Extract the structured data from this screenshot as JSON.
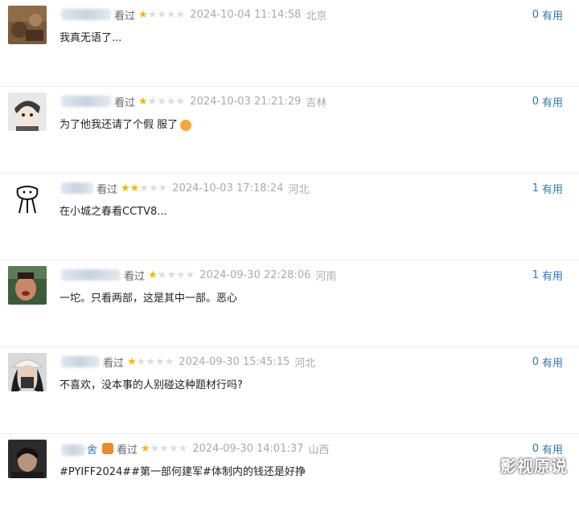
{
  "reviews": [
    {
      "user_suffix": "",
      "action": "看过",
      "rating": 1,
      "time": "2024-10-04 11:14:58",
      "location": "北京",
      "content": "我真无语了...",
      "votes": "0",
      "useful_label": "有用"
    },
    {
      "user_suffix": "",
      "action": "看过",
      "rating": 1,
      "time": "2024-10-03 21:21:29",
      "location": "吉林",
      "content": "为了他我还请了个假 服了",
      "votes": "0",
      "useful_label": "有用"
    },
    {
      "user_suffix": "",
      "action": "看过",
      "rating": 2,
      "time": "2024-10-03 17:18:24",
      "location": "河北",
      "content": "在小城之春看CCTV8...",
      "votes": "1",
      "useful_label": "有用"
    },
    {
      "user_suffix": "",
      "action": "看过",
      "rating": 1,
      "time": "2024-09-30 22:28:06",
      "location": "河南",
      "content": "一坨。只看两部，这是其中一部。恶心",
      "votes": "1",
      "useful_label": "有用"
    },
    {
      "user_suffix": "",
      "action": "看过",
      "rating": 1,
      "time": "2024-09-30 15:45:15",
      "location": "河北",
      "content": "不喜欢，没本事的人别碰这种题材行吗?",
      "votes": "0",
      "useful_label": "有用"
    },
    {
      "user_suffix": "舍",
      "action": "看过",
      "rating": 1,
      "time": "2024-09-30 14:01:37",
      "location": "山西",
      "content": "#PYIFF2024##第一部何建军#体制内的钱还是好挣",
      "votes": "0",
      "useful_label": "有用"
    }
  ],
  "watermark": "影视原说",
  "colors": {
    "star_on": "#f7b500",
    "star_off": "#dddddd",
    "link": "#3377aa"
  }
}
